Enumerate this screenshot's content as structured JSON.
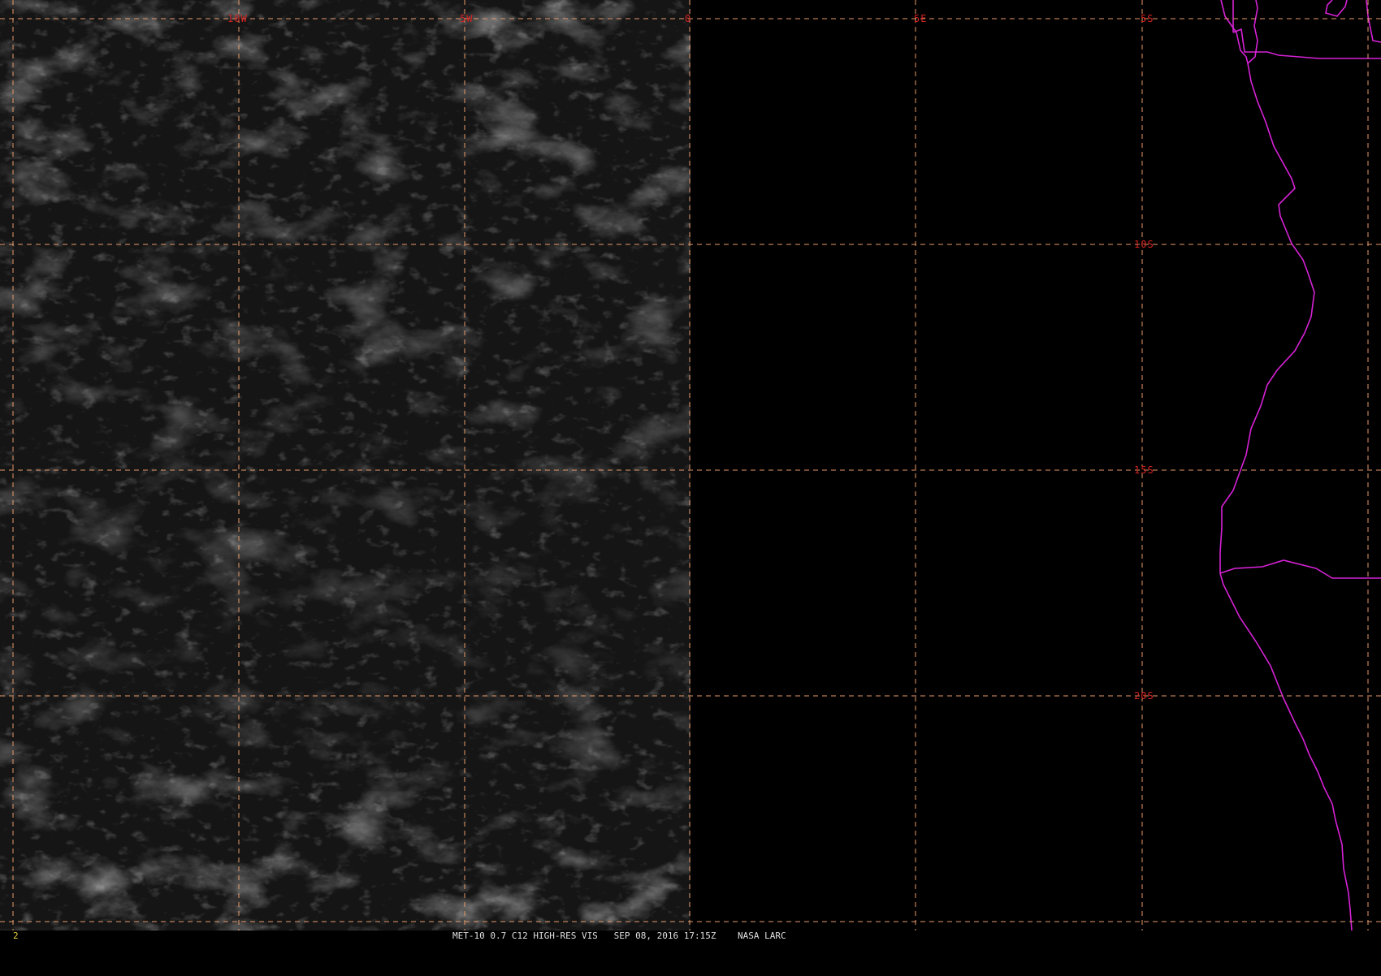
{
  "grid": {
    "longitude_labels": [
      "10W",
      "5W",
      "0",
      "5E"
    ],
    "latitude_labels": [
      "5S",
      "10S",
      "15S",
      "20S"
    ],
    "label_color": "#d32222",
    "line_color": "#e79a6a"
  },
  "coastline_color": "#d622d6",
  "status": {
    "frame_number": "2",
    "caption": "MET-10 0.7 C12 HIGH-RES VIS   SEP 08, 2016 17:15Z    NASA LARC"
  }
}
